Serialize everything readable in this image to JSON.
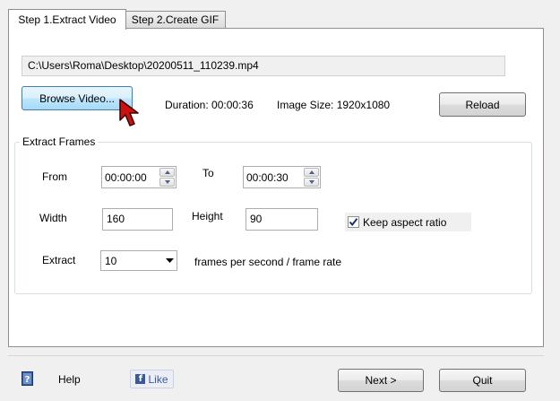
{
  "tabs": [
    {
      "label": "Step 1.Extract Video",
      "active": true
    },
    {
      "label": "Step 2.Create GIF",
      "active": false
    }
  ],
  "video": {
    "file_path": "C:\\Users\\Roma\\Desktop\\20200511_110239.mp4",
    "browse_label": "Browse Video...",
    "duration": "Duration: 00:00:36",
    "image_size": "Image Size: 1920x1080",
    "reload_label": "Reload"
  },
  "extract_frames": {
    "title": "Extract Frames",
    "from_label": "From",
    "from_value": "00:00:00",
    "to_label": "To",
    "to_value": "00:00:30",
    "width_label": "Width",
    "width_value": "160",
    "height_label": "Height",
    "height_value": "90",
    "keep_aspect_label": "Keep aspect ratio",
    "keep_aspect_checked": true,
    "extract_label": "Extract",
    "extract_value": "10",
    "rate_label": "frames per second / frame rate"
  },
  "footer": {
    "help_label": "Help",
    "like_label": "Like",
    "like_glyph": "f",
    "next_label": "Next >",
    "quit_label": "Quit"
  },
  "colors": {
    "accent": "#3c7fb1",
    "cursor": "#cc1111",
    "facebook": "#3b5998"
  },
  "icons": {
    "help": "help-book-icon",
    "cursor": "mouse-pointer-icon",
    "facebook": "facebook-icon"
  }
}
